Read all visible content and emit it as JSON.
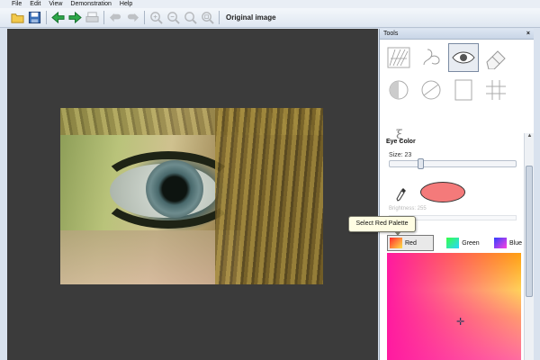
{
  "menu": {
    "file": "File",
    "edit": "Edit",
    "view": "View",
    "demonstration": "Demonstration",
    "help": "Help"
  },
  "toolbar": {
    "original_label": "Original image",
    "icons": [
      "open-folder-icon",
      "save-icon",
      "back-arrow-icon",
      "forward-arrow-icon",
      "print-icon",
      "undo-icon",
      "redo-icon",
      "zoom-in-icon",
      "zoom-out-icon",
      "zoom-fit-icon",
      "zoom-actual-icon"
    ]
  },
  "panel": {
    "title": "Tools",
    "close": "×",
    "tools": [
      "hair-texture-tool-icon",
      "lips-tool-icon",
      "eye-tool-icon",
      "eraser-tool-icon",
      "half-circle-tool-icon",
      "circle-split-tool-icon",
      "page-tool-icon",
      "grid-tool-icon",
      "xi-tool-icon"
    ],
    "xi_glyph": "ξ",
    "eye_color_title": "Eye Color",
    "size_label": "Size: 23",
    "size_value": 23,
    "brightness_label": "Brightness: 255",
    "tooltip": "Select Red Palette",
    "palettes": {
      "red": "Red",
      "green": "Green",
      "blue": "Blue",
      "selected": "Red"
    },
    "crosshair": "✛"
  },
  "colors": {
    "canvas_bg": "#3b3b3b",
    "swatch": "#f47a7a",
    "toolbar_arrows": "#2da84a"
  }
}
